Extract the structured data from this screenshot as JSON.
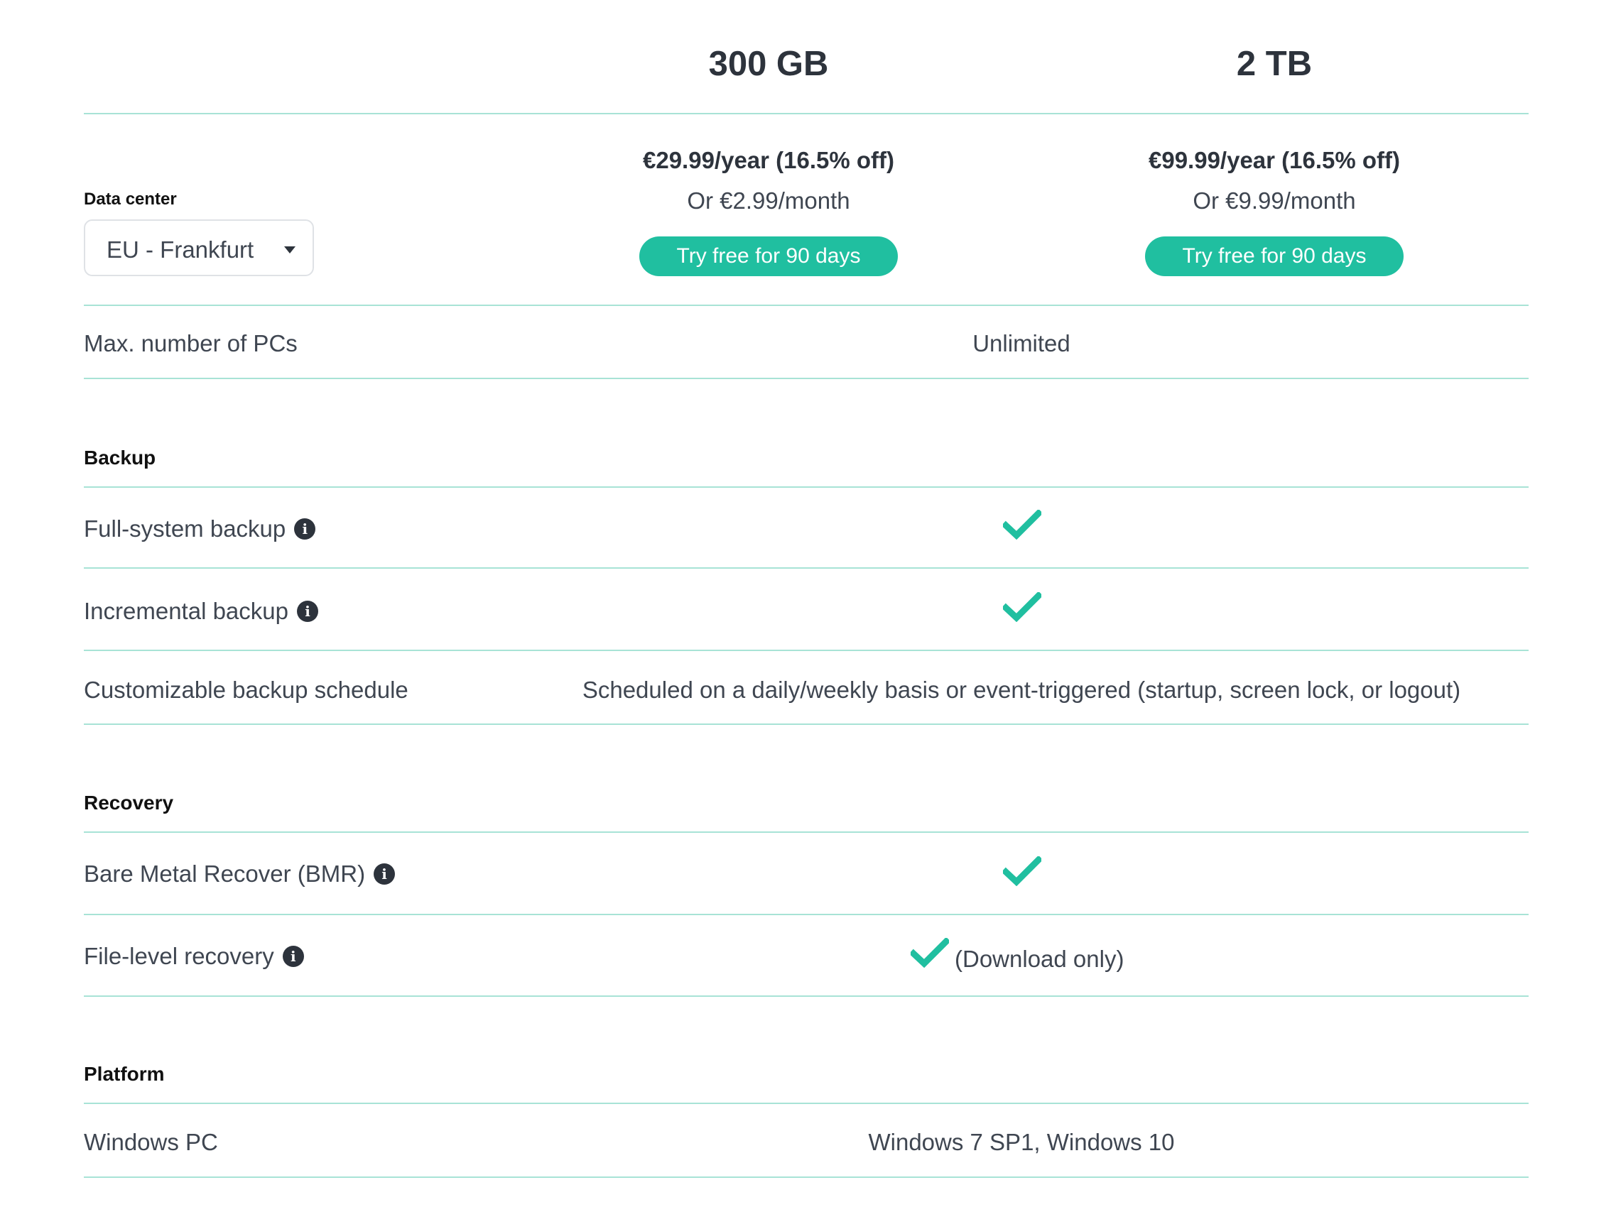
{
  "plans": [
    {
      "name": "300 GB",
      "price": "€29.99/year (16.5% off)",
      "monthly": "Or €2.99/month",
      "cta": "Try free for 90 days"
    },
    {
      "name": "2 TB",
      "price": "€99.99/year (16.5% off)",
      "monthly": "Or €9.99/month",
      "cta": "Try free for 90 days"
    }
  ],
  "data_center": {
    "label": "Data center",
    "selected": "EU - Frankfurt"
  },
  "max_pcs": {
    "label": "Max. number of PCs",
    "value": "Unlimited"
  },
  "sections": {
    "backup": "Backup",
    "recovery": "Recovery",
    "platform": "Platform"
  },
  "backup_rows": {
    "full_system": "Full-system backup",
    "incremental": "Incremental backup",
    "schedule_label": "Customizable backup schedule",
    "schedule_value": "Scheduled on a daily/weekly basis or event-triggered (startup, screen lock, or logout)"
  },
  "recovery_rows": {
    "bmr": "Bare Metal Recover (BMR)",
    "file_level": "File-level recovery",
    "file_level_note": "(Download only)"
  },
  "platform_rows": {
    "windows_label": "Windows PC",
    "windows_value": "Windows 7 SP1, Windows 10"
  },
  "icons": {
    "info": "i"
  },
  "colors": {
    "accent": "#20bfa0",
    "divider": "#a8e3d6",
    "text": "#3f4651",
    "heading": "#2d333c"
  }
}
